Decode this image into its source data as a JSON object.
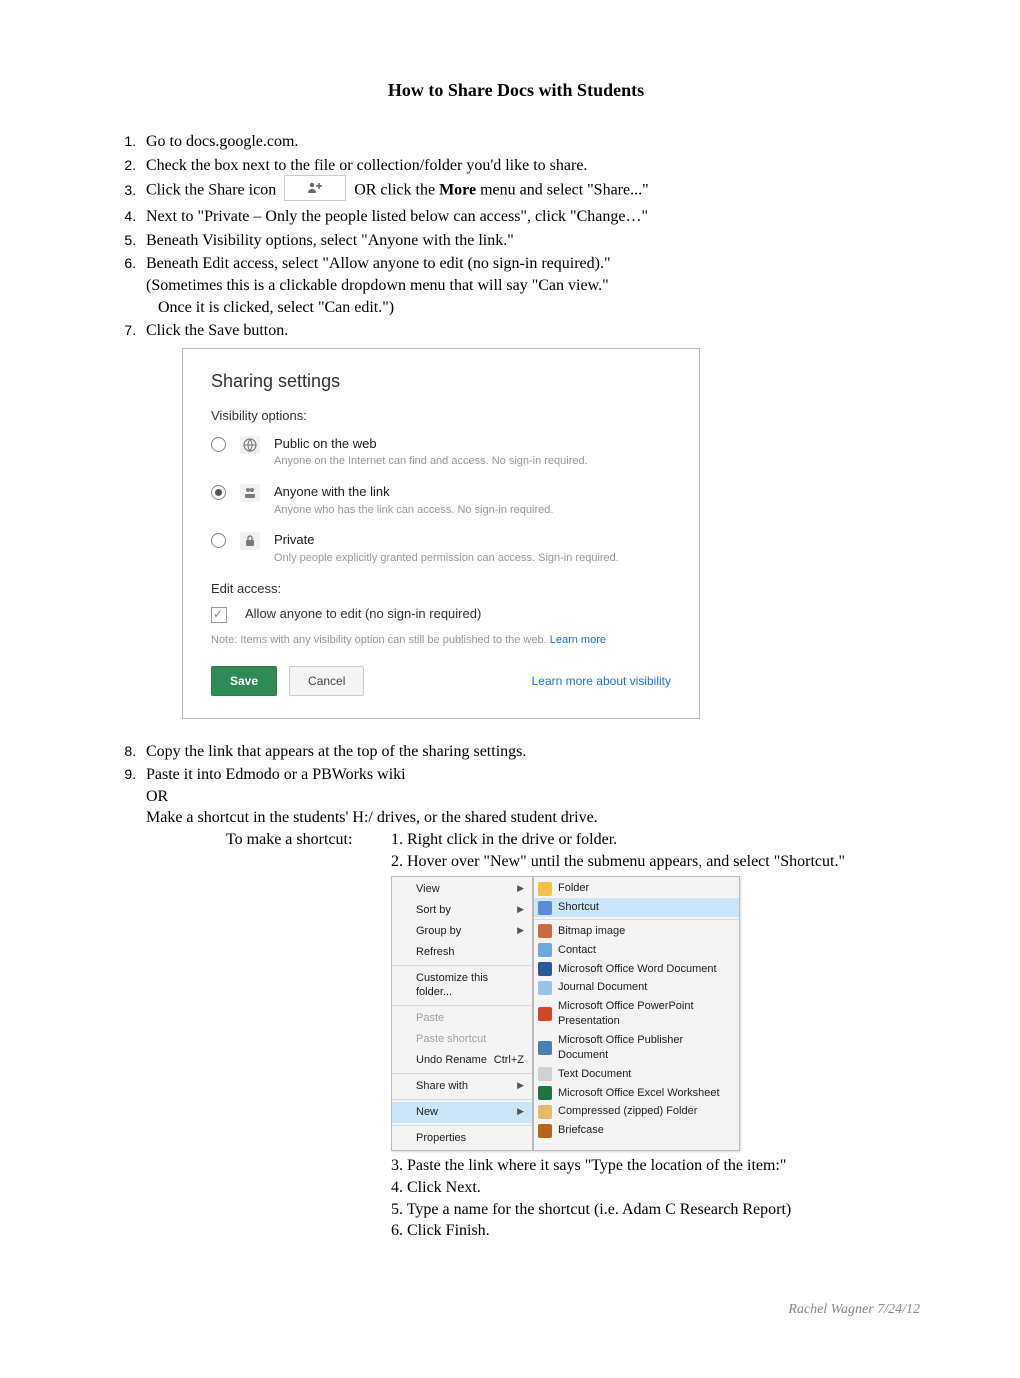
{
  "title": "How to Share Docs with Students",
  "steps": {
    "s1": "Go to docs.google.com.",
    "s2": "Check the box next to the file or collection/folder you'd like to share.",
    "s3a": "Click the Share icon",
    "s3b": " OR click the ",
    "s3c": "More",
    "s3d": " menu and select \"Share...\"",
    "s4": "Next to \"Private – Only the people listed below can access\", click \"Change…\"",
    "s5": "Beneath Visibility options, select \"Anyone with the link.\"",
    "s6": "Beneath Edit access, select \"Allow anyone to edit (no sign-in required).\"",
    "s6b": "(Sometimes this is a clickable dropdown menu that will say \"Can view.\"",
    "s6c": "Once it is clicked, select \"Can edit.\")",
    "s7": "Click the Save button.",
    "s8": "Copy the link that appears at the top of the sharing settings.",
    "s9": "Paste it into Edmodo or a PBWorks wiki",
    "s9b": "OR",
    "s9c": "Make a shortcut in the students' H:/ drives, or the shared student drive."
  },
  "sharing_panel": {
    "title": "Sharing settings",
    "visibility_label": "Visibility options:",
    "options": [
      {
        "title": "Public on the web",
        "desc": "Anyone on the Internet can find and access. No sign-in required.",
        "checked": false
      },
      {
        "title": "Anyone with the link",
        "desc": "Anyone who has the link can access. No sign-in required.",
        "checked": true
      },
      {
        "title": "Private",
        "desc": "Only people explicitly granted permission can access. Sign-in required.",
        "checked": false
      }
    ],
    "edit_label": "Edit access:",
    "edit_option": "Allow anyone to edit (no sign-in required)",
    "note_a": "Note: Items with any visibility option can still be published to the web. ",
    "note_link": "Learn more",
    "save": "Save",
    "cancel": "Cancel",
    "learn": "Learn more about visibility"
  },
  "shortcut": {
    "lead": "To make a shortcut:",
    "s1": "1. Right click in the drive or folder.",
    "s2": "2. Hover over \"New\" until the submenu appears, and select \"Shortcut.\"",
    "s3": "3. Paste the link where it says \"Type the location of the item:\"",
    "s4": "4. Click Next.",
    "s5": "5. Type a name for the shortcut (i.e. Adam C Research Report)",
    "s6": "6. Click Finish."
  },
  "context_menu": {
    "left": [
      {
        "label": "View",
        "arrow": true
      },
      {
        "label": "Sort by",
        "arrow": true
      },
      {
        "label": "Group by",
        "arrow": true
      },
      {
        "label": "Refresh"
      },
      {
        "sep": true
      },
      {
        "label": "Customize this folder..."
      },
      {
        "sep": true
      },
      {
        "label": "Paste",
        "dim": true
      },
      {
        "label": "Paste shortcut",
        "dim": true
      },
      {
        "label": "Undo Rename",
        "shortcut": "Ctrl+Z"
      },
      {
        "sep": true
      },
      {
        "label": "Share with",
        "arrow": true
      },
      {
        "sep": true
      },
      {
        "label": "New",
        "arrow": true,
        "hover": true
      },
      {
        "sep": true
      },
      {
        "label": "Properties"
      }
    ],
    "right": [
      {
        "label": "Folder",
        "color": "#f4c04a"
      },
      {
        "label": "Shortcut",
        "color": "#5b8bd4",
        "hover": true
      },
      {
        "sep": true
      },
      {
        "label": "Bitmap image",
        "color": "#c86b43"
      },
      {
        "label": "Contact",
        "color": "#6fa8dc"
      },
      {
        "label": "Microsoft Office Word Document",
        "color": "#2b579a"
      },
      {
        "label": "Journal Document",
        "color": "#9cc2e5"
      },
      {
        "label": "Microsoft Office PowerPoint Presentation",
        "color": "#d24726"
      },
      {
        "label": "Microsoft Office Publisher Document",
        "color": "#4a7db8"
      },
      {
        "label": "Text Document",
        "color": "#d0d0d0"
      },
      {
        "label": "Microsoft Office Excel Worksheet",
        "color": "#217346"
      },
      {
        "label": "Compressed (zipped) Folder",
        "color": "#e8b96c"
      },
      {
        "label": "Briefcase",
        "color": "#b5651d"
      }
    ]
  },
  "footer": "Rachel Wagner 7/24/12"
}
